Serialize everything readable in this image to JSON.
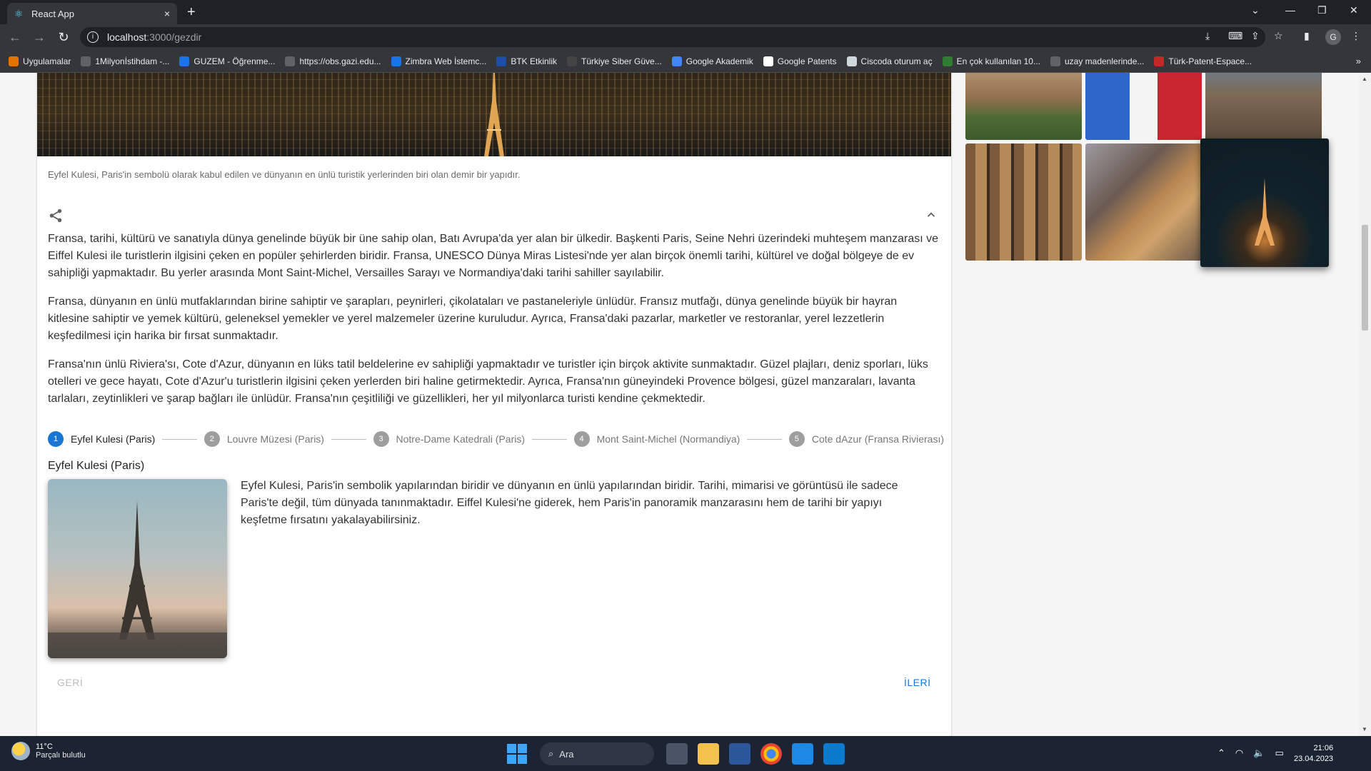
{
  "browser": {
    "tab_title": "React App",
    "tab_close": "×",
    "new_tab": "+",
    "url_host": "localhost",
    "url_path": ":3000/gezdir",
    "profile_initial": "G",
    "window_controls": [
      "⌄",
      "—",
      "❐",
      "✕"
    ],
    "bookmarks": [
      {
        "label": "Uygulamalar",
        "icon": "apps-grid-icon",
        "color": "#e37400"
      },
      {
        "label": "1Milyonİstihdam -...",
        "icon": "favicon-icon",
        "color": "#5f6368"
      },
      {
        "label": "GUZEM - Öğrenme...",
        "icon": "favicon-icon",
        "color": "#1a73e8"
      },
      {
        "label": "https://obs.gazi.edu...",
        "icon": "globe-icon",
        "color": "#5f6368"
      },
      {
        "label": "Zimbra Web İstemc...",
        "icon": "zimbra-icon",
        "color": "#1a73e8"
      },
      {
        "label": "BTK Etkinlik",
        "icon": "favicon-icon",
        "color": "#1d4ea8"
      },
      {
        "label": "Türkiye Siber Güve...",
        "icon": "favicon-icon",
        "color": "#444"
      },
      {
        "label": "Google Akademik",
        "icon": "scholar-icon",
        "color": "#4285f4"
      },
      {
        "label": "Google Patents",
        "icon": "google-icon",
        "color": "#ffffff"
      },
      {
        "label": "Ciscoda oturum aç",
        "icon": "favicon-icon",
        "color": "#cfd8dc"
      },
      {
        "label": "En çok kullanılan 10...",
        "icon": "favicon-icon",
        "color": "#2e7d32"
      },
      {
        "label": "uzay madenlerinde...",
        "icon": "globe-icon",
        "color": "#5f6368"
      },
      {
        "label": "Türk-Patent-Espace...",
        "icon": "favicon-icon",
        "color": "#c62828"
      }
    ],
    "more_bookmarks": "»"
  },
  "content": {
    "caption": "Eyfel Kulesi, Paris'in sembolü olarak kabul edilen ve dünyanın en ünlü turistik yerlerinden biri olan demir bir yapıdır.",
    "paragraphs": [
      "Fransa, tarihi, kültürü ve sanatıyla dünya genelinde büyük bir üne sahip olan, Batı Avrupa'da yer alan bir ülkedir. Başkenti Paris, Seine Nehri üzerindeki muhteşem manzarası ve Eiffel Kulesi ile turistlerin ilgisini çeken en popüler şehirlerden biridir. Fransa, UNESCO Dünya Miras Listesi'nde yer alan birçok önemli tarihi, kültürel ve doğal bölgeye de ev sahipliği yapmaktadır. Bu yerler arasında Mont Saint-Michel, Versailles Sarayı ve Normandiya'daki tarihi sahiller sayılabilir.",
      "Fransa, dünyanın en ünlü mutfaklarından birine sahiptir ve şarapları, peynirleri, çikolataları ve pastaneleriyle ünlüdür. Fransız mutfağı, dünya genelinde büyük bir hayran kitlesine sahiptir ve yemek kültürü, geleneksel yemekler ve yerel malzemeler üzerine kuruludur. Ayrıca, Fransa'daki pazarlar, marketler ve restoranlar, yerel lezzetlerin keşfedilmesi için harika bir fırsat sunmaktadır.",
      "Fransa'nın ünlü Riviera'sı, Cote d'Azur, dünyanın en lüks tatil beldelerine ev sahipliği yapmaktadır ve turistler için birçok aktivite sunmaktadır. Güzel plajları, deniz sporları, lüks otelleri ve gece hayatı, Cote d'Azur'u turistlerin ilgisini çeken yerlerden biri haline getirmektedir. Ayrıca, Fransa'nın güneyindeki Provence bölgesi, güzel manzaraları, lavanta tarlaları, zeytinlikleri ve şarap bağları ile ünlüdür. Fransa'nın çeşitliliği ve güzellikleri, her yıl milyonlarca turisti kendine çekmektedir."
    ],
    "steps": [
      {
        "num": "1",
        "label": "Eyfel Kulesi (Paris)"
      },
      {
        "num": "2",
        "label": "Louvre Müzesi (Paris)"
      },
      {
        "num": "3",
        "label": "Notre-Dame Katedrali (Paris)"
      },
      {
        "num": "4",
        "label": "Mont Saint-Michel (Normandiya)"
      },
      {
        "num": "5",
        "label": "Cote dAzur (Fransa Rivierası)"
      }
    ],
    "active_step_title": "Eyfel Kulesi (Paris)",
    "active_step_text": "Eyfel Kulesi, Paris'in sembolik yapılarından biridir ve dünyanın en ünlü yapılarından biridir. Tarihi, mimarisi ve görüntüsü ile sadece Paris'te değil, tüm dünyada tanınmaktadır. Eiffel Kulesi'ne giderek, hem Paris'in panoramik manzarasını hem de tarihi bir yapıyı keşfetme fırsatını yakalayabilirsiniz.",
    "back_label": "GERİ",
    "next_label": "İLERİ",
    "accent_color": "#1976d2"
  },
  "taskbar": {
    "temperature": "11°C",
    "weather": "Parçalı bulutlu",
    "search_label": "Ara",
    "time": "21:06",
    "date": "23.04.2023"
  }
}
